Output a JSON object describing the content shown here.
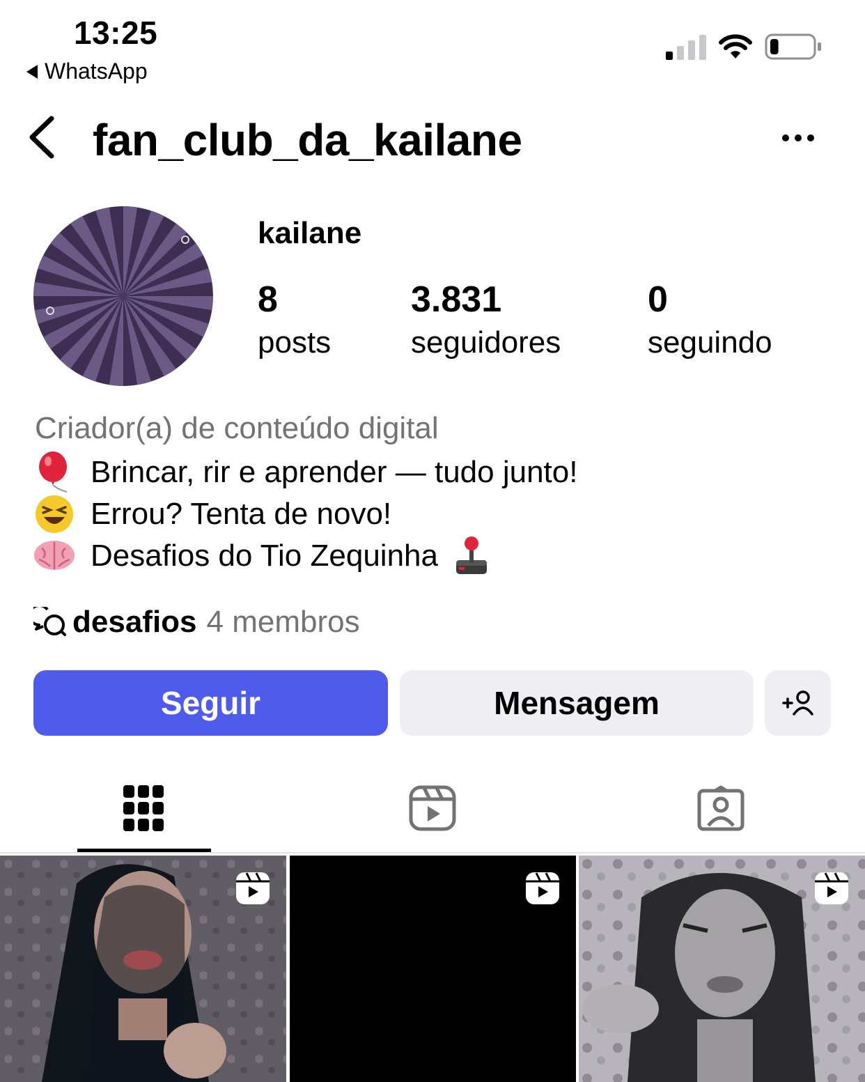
{
  "status_bar": {
    "time": "13:25",
    "back_app": "WhatsApp",
    "battery_level": 0.2
  },
  "header": {
    "handle": "fan_club_da_kailane"
  },
  "profile": {
    "display_name": "kailane",
    "stats": [
      {
        "value": "8",
        "label": "posts"
      },
      {
        "value": "3.831",
        "label": "seguidores"
      },
      {
        "value": "0",
        "label": "seguindo"
      }
    ],
    "category": "Criador(a) de conteúdo digital",
    "bio": [
      {
        "emoji": "balloon",
        "text": "Brincar, rir e aprender — tudo junto!"
      },
      {
        "emoji": "laughing-face",
        "text": "Errou? Tenta de novo!"
      },
      {
        "emoji": "brain",
        "text": "Desafios do Tio Zequinha"
      }
    ],
    "trailing_emoji": "joystick",
    "channel": {
      "name": "desafios",
      "members": "4 membros"
    }
  },
  "actions": {
    "follow": "Seguir",
    "message": "Mensagem"
  },
  "tabs": [
    "grid-icon",
    "reels-icon",
    "tagged-icon"
  ],
  "active_tab": "grid-icon",
  "grid": [
    {
      "type": "reel",
      "content": "video-thumbnail"
    },
    {
      "type": "reel",
      "content": "black-frame"
    },
    {
      "type": "reel",
      "content": "video-thumbnail"
    }
  ],
  "colors": {
    "accent": "#4f5ceb",
    "secondary_button": "#efeff3",
    "muted_text": "#737373"
  }
}
